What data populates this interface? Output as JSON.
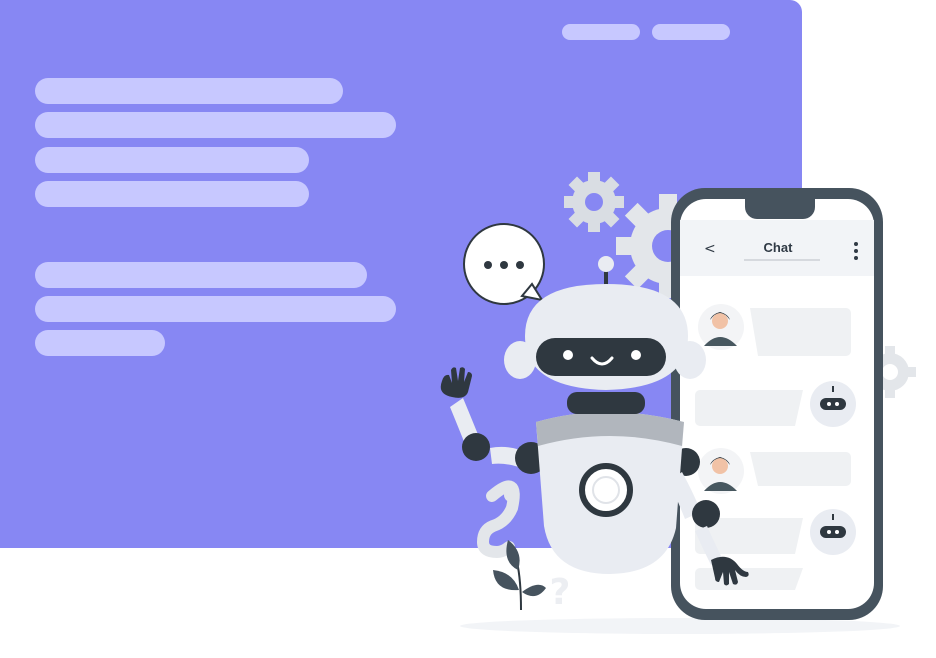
{
  "chat": {
    "title": "Chat",
    "back_icon": "chevron-left-icon",
    "menu_icon": "more-vertical-icon"
  },
  "illustration": {
    "speech_bubble_text": "•••",
    "question_mark": "?",
    "question_mark_small": "?"
  },
  "colors": {
    "accent": "#8787f3",
    "placeholder": "#c7c8ff",
    "phone_frame": "#46535e",
    "robot_dark": "#2f3840",
    "robot_light": "#e9ecf2"
  }
}
